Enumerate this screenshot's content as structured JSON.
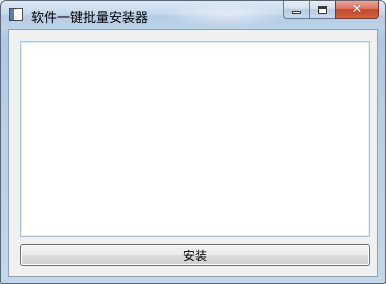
{
  "window": {
    "title": "软件一键批量安装器",
    "icon": "application-window-icon"
  },
  "caption_buttons": {
    "minimize_icon": "minimize-icon",
    "maximize_icon": "maximize-icon",
    "close_icon": "close-icon",
    "close_glyph": "✕"
  },
  "software_list": {
    "items": []
  },
  "install_button": {
    "label": "安装"
  },
  "colors": {
    "close_button": "#c4462c",
    "list_border": "#a6c4dd",
    "client_background": "#f0f0f0"
  }
}
